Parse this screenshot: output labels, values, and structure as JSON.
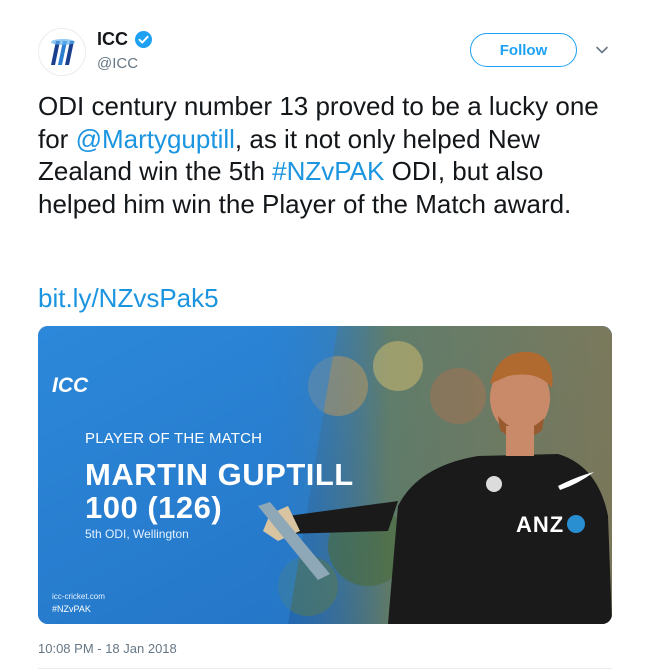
{
  "header": {
    "name": "ICC",
    "handle": "@ICC",
    "follow_label": "Follow",
    "verified_icon": "verified-badge-icon",
    "menu_icon": "chevron-down-icon"
  },
  "tweet": {
    "text_part1": "ODI century number 13 proved to be a lucky one for ",
    "mention": "@Martyguptill",
    "text_part2": ", as it not only helped New Zealand win the 5th ",
    "hashtag": "#NZvPAK",
    "text_part3": " ODI, but also helped him win the Player of the Match award.",
    "link": "bit.ly/NZvsPak5",
    "timestamp": "10:08 PM - 18 Jan 2018"
  },
  "media": {
    "logo_text": "ICC",
    "award": "PLAYER OF THE MATCH",
    "player": "MARTIN GUPTILL",
    "score": "100 (126)",
    "venue": "5th ODI, Wellington",
    "site": "icc-cricket.com",
    "hashtag": "#NZvPAK",
    "sponsor": "ANZ"
  },
  "colors": {
    "link": "#1b95e0",
    "verified": "#1da1f2",
    "card_blue": "#1f6fb8"
  }
}
